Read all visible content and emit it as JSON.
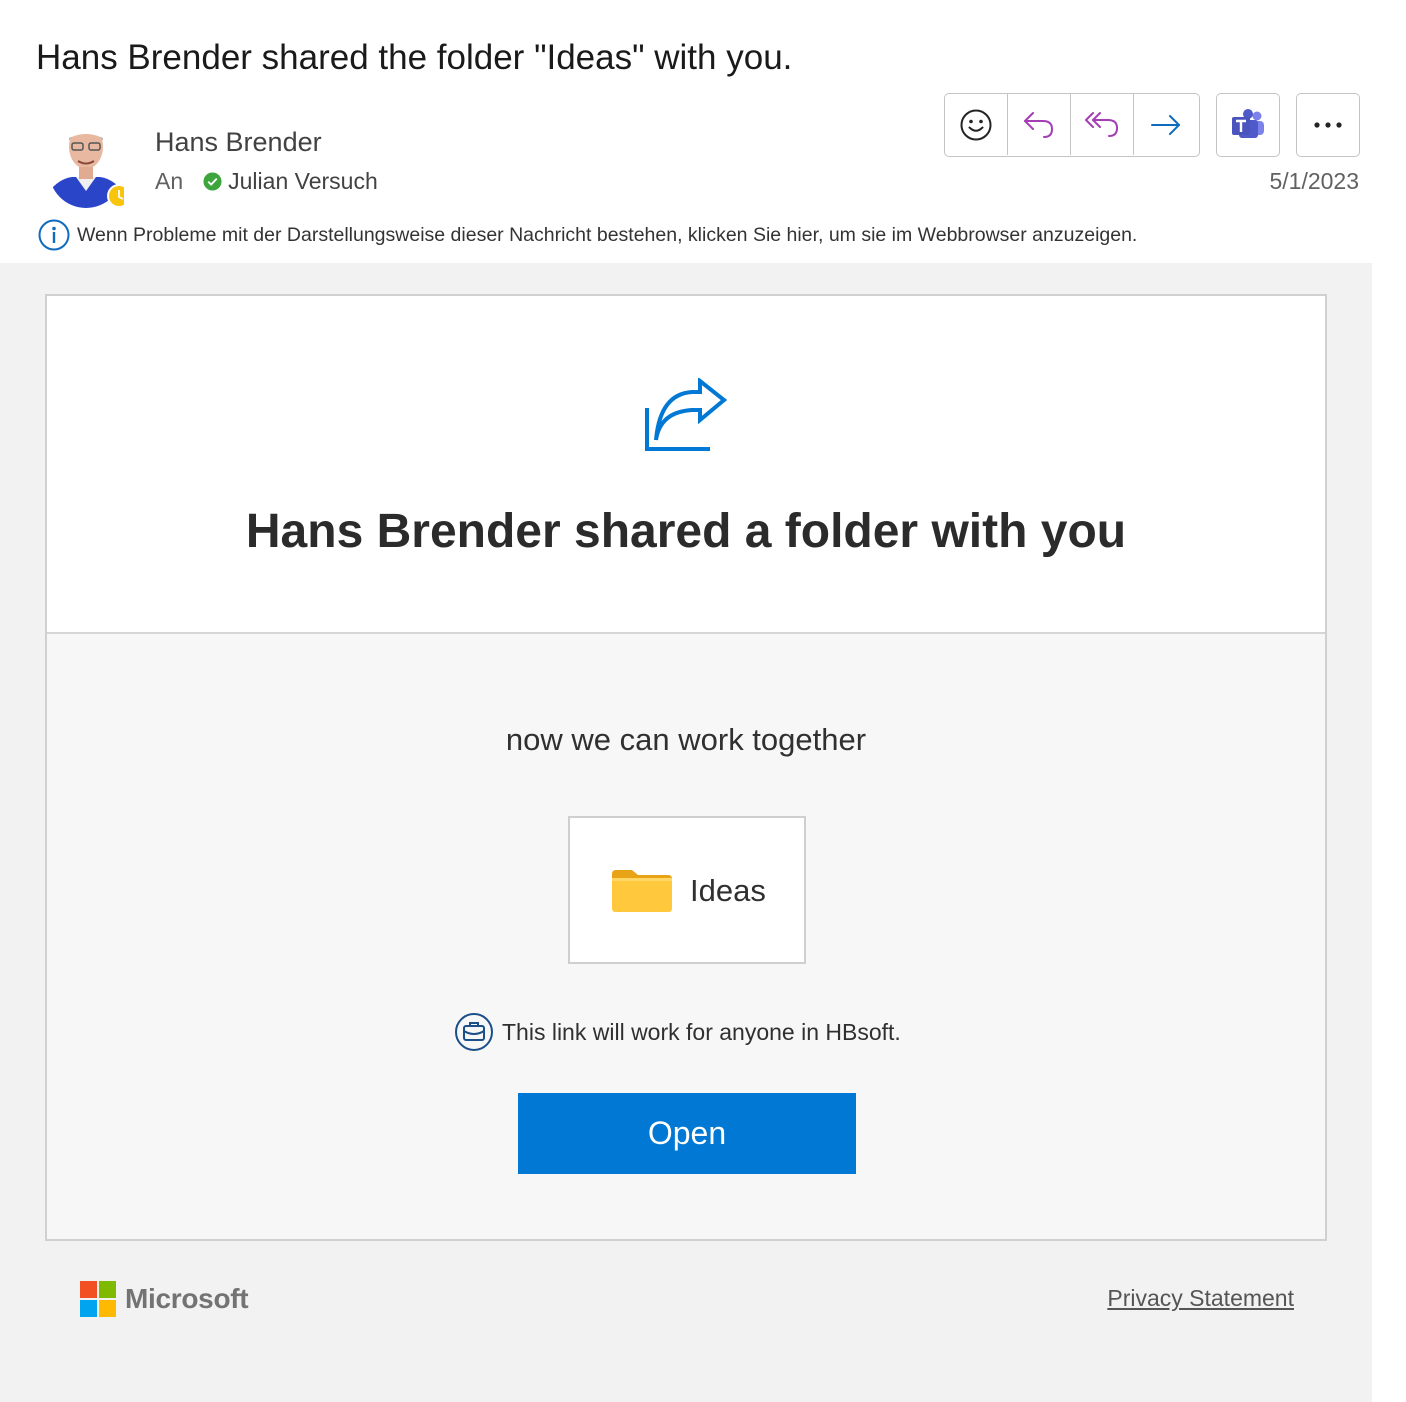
{
  "email": {
    "subject": "Hans Brender shared the folder \"Ideas\" with you.",
    "sender": "Hans Brender",
    "to_label": "An",
    "recipient": "Julian Versuch",
    "date": "5/1/2023",
    "info_bar": "Wenn Probleme mit der Darstellungsweise dieser Nachricht bestehen, klicken Sie hier, um sie im Webbrowser anzuzeigen."
  },
  "toolbar": {
    "buttons": [
      "smiley-icon",
      "reply-icon",
      "reply-all-icon",
      "forward-icon",
      "teams-icon",
      "more-icon"
    ]
  },
  "card": {
    "title": "Hans Brender shared a folder with you",
    "message": "now we can work together",
    "folder_name": "Ideas",
    "link_note": "This link will work for anyone in HBsoft.",
    "open_label": "Open"
  },
  "footer": {
    "brand": "Microsoft",
    "privacy": "Privacy Statement"
  },
  "colors": {
    "accent": "#0078d4",
    "reply_purple": "#a33eb5",
    "forward_blue": "#0f6cbd",
    "teams": "#5059c9",
    "presence_away": "#f8c40c",
    "presence_ok": "#3ca63c",
    "folder": "#ffc83d"
  }
}
